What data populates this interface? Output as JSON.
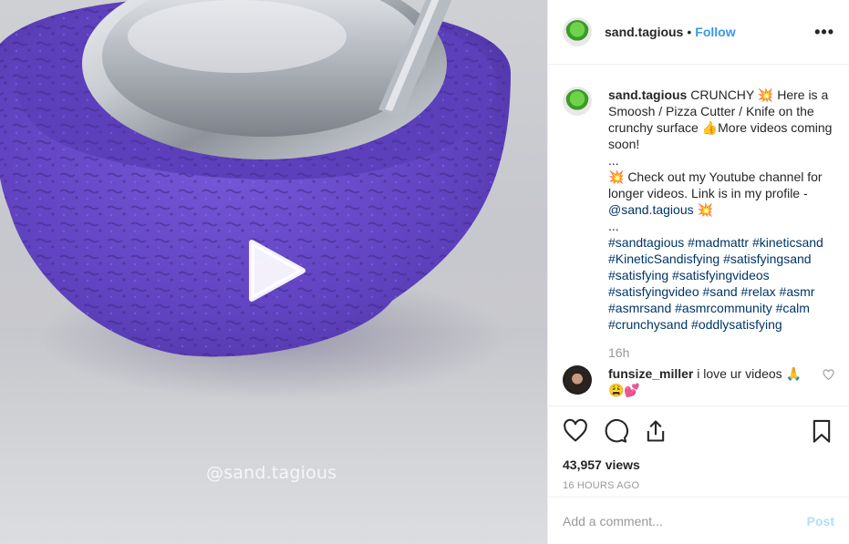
{
  "media": {
    "watermark": "@sand.tagious",
    "play_icon": "play-icon"
  },
  "header": {
    "username": "sand.tagious",
    "separator": "•",
    "follow_label": "Follow",
    "more_label": "•••"
  },
  "caption": {
    "username": "sand.tagious",
    "line1": "CRUNCHY 💥 Here is a Smoosh / Pizza Cutter / Knife on the crunchy surface 👍More videos coming soon!",
    "ellipsis1": "...",
    "line2": "💥 Check out my Youtube channel for longer videos. Link is in my profile -",
    "mention": "@sand.tagious",
    "mention_suffix": " 💥",
    "ellipsis2": "...",
    "hashtags": "#sandtagious #madmattr #kineticsand #KineticSandisfying #satisfyingsand #satisfying #satisfyingvideos #satisfyingvideo #sand #relax #asmr #asmrsand #asmrcommunity #calm #crunchysand #oddlysatisfying",
    "time_ago": "16h"
  },
  "comments": [
    {
      "username": "funsize_miller",
      "text": "i love ur videos 🙏 😩💕"
    }
  ],
  "actions": {
    "views": "43,957 views",
    "date": "16 HOURS AGO",
    "icons": [
      "heart-icon",
      "comment-icon",
      "share-icon",
      "bookmark-icon"
    ]
  },
  "add_comment": {
    "placeholder": "Add a comment...",
    "post_label": "Post"
  },
  "colors": {
    "link": "#3897f0",
    "hashtag": "#003569",
    "sand": "#6a4cc9",
    "muted": "#999999"
  }
}
